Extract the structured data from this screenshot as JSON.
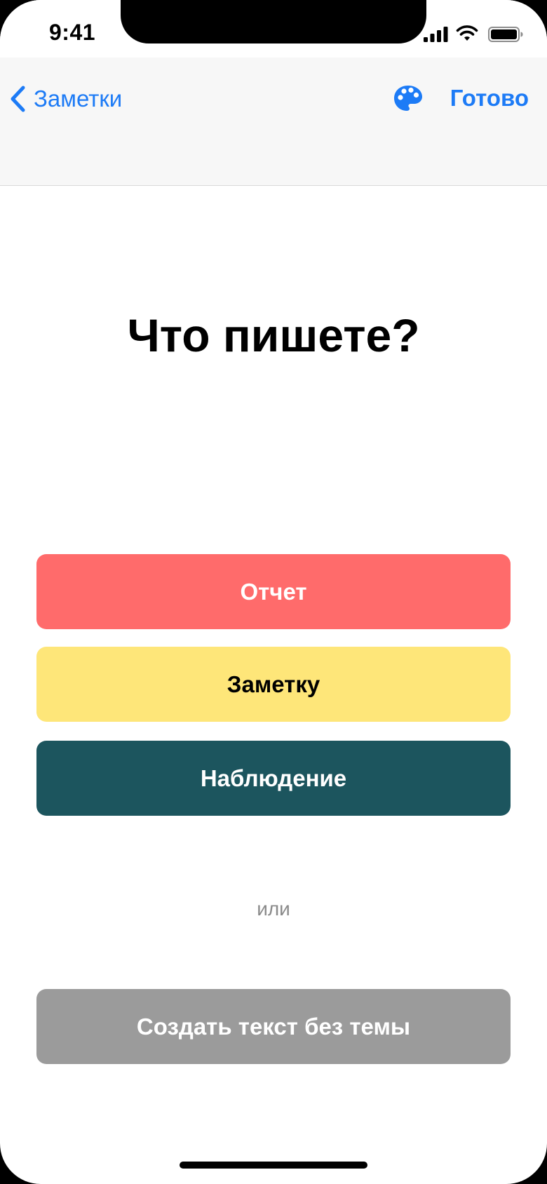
{
  "status_bar": {
    "time": "9:41"
  },
  "nav": {
    "back_label": "Заметки",
    "done_label": "Готово",
    "back_icon": "chevron-left-icon",
    "palette_icon": "palette-icon",
    "accent_color": "#1d7bf6"
  },
  "main": {
    "title": "Что пишете?",
    "buttons": [
      {
        "label": "Отчет",
        "color": "#ff6b6b"
      },
      {
        "label": "Заметку",
        "color": "#fee679"
      },
      {
        "label": "Наблюдение",
        "color": "#1c555e"
      }
    ],
    "or_label": "или",
    "plain_button_label": "Создать текст без темы",
    "plain_button_color": "#9b9b9b"
  }
}
